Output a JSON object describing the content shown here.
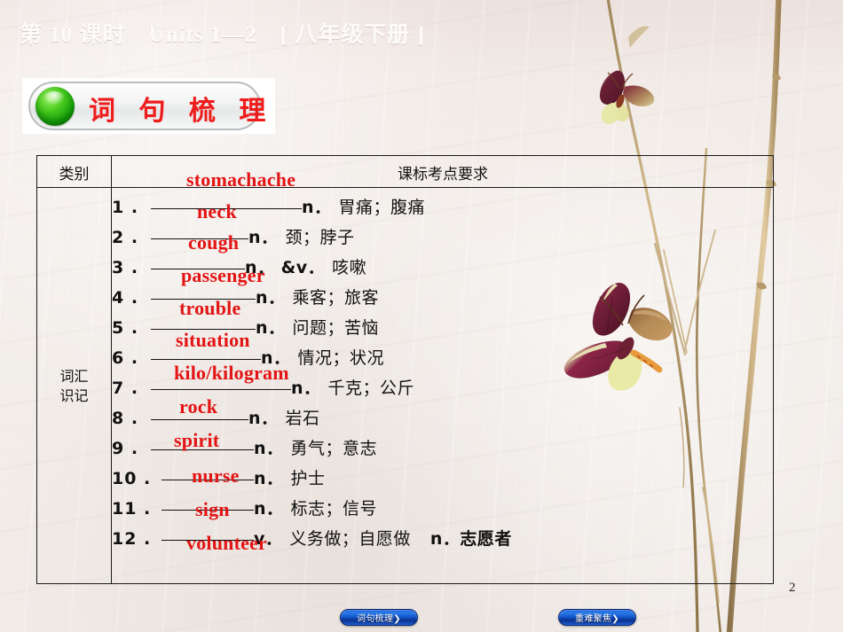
{
  "header": {
    "lesson": "第 10 课时",
    "units": "Units 1—2",
    "grade": "[ 八年级下册 ]"
  },
  "banner": {
    "label": "词 句 梳 理",
    "ball_color": "#17a30a",
    "text_color": "#ef1c1c"
  },
  "table": {
    "headers": [
      "类别",
      "课标考点要求"
    ],
    "category": "词汇识记",
    "answer_color": "#e31414",
    "rows": [
      {
        "num": "1 .",
        "answer": "stomachache",
        "pos": "n．",
        "meaning": "胃痛；腹痛",
        "extra": ""
      },
      {
        "num": "2 .",
        "answer": "neck",
        "pos": "n．",
        "meaning": "颈；脖子",
        "extra": ""
      },
      {
        "num": "3 .",
        "answer": "cough",
        "pos": "n． &v．",
        "meaning": "咳嗽",
        "extra": ""
      },
      {
        "num": "4 .",
        "answer": "passenger",
        "pos": "n．",
        "meaning": "乘客；旅客",
        "extra": ""
      },
      {
        "num": "5 .",
        "answer": "trouble",
        "pos": "n．",
        "meaning": "问题；苦恼",
        "extra": ""
      },
      {
        "num": "6 .",
        "answer": "situation",
        "pos": "n．",
        "meaning": "情况；状况",
        "extra": ""
      },
      {
        "num": "7 .",
        "answer": "kilo/kilogram",
        "pos": "n．",
        "meaning": "千克；公斤",
        "extra": ""
      },
      {
        "num": "8 .",
        "answer": "rock",
        "pos": "n．",
        "meaning": "岩石",
        "extra": ""
      },
      {
        "num": "9 .",
        "answer": "spirit",
        "pos": "n．",
        "meaning": "勇气；意志",
        "extra": ""
      },
      {
        "num": "10 .",
        "answer": "nurse",
        "pos": "n．",
        "meaning": "护士",
        "extra": ""
      },
      {
        "num": "11 .",
        "answer": "sign",
        "pos": "n．",
        "meaning": "标志；信号",
        "extra": ""
      },
      {
        "num": "12 .",
        "answer": "volunteer",
        "pos": "v．",
        "meaning": "义务做；自愿做",
        "extra": "n．志愿者"
      }
    ]
  },
  "footer": {
    "nav_left": "词句梳理❯",
    "nav_right": "重难聚焦❯",
    "page_number": "2"
  }
}
